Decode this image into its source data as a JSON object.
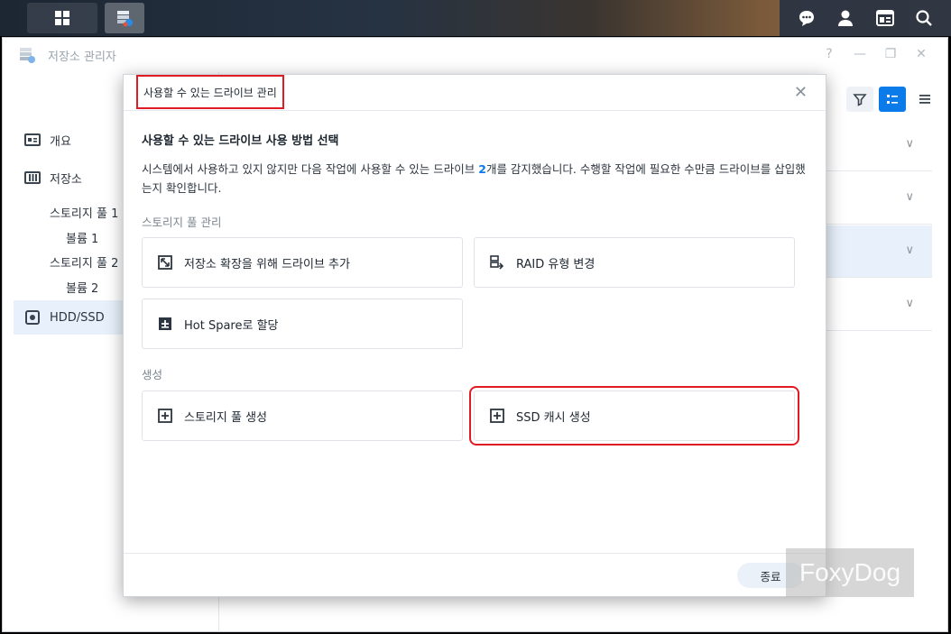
{
  "window": {
    "title": "저장소 관리자",
    "controls": [
      "?",
      "—",
      "❐",
      "✕"
    ]
  },
  "sidebar": {
    "items": [
      {
        "label": "개요",
        "icon": "overview-icon"
      },
      {
        "label": "저장소",
        "icon": "storage-icon"
      },
      {
        "label": "HDD/SSD",
        "icon": "hdd-icon"
      }
    ],
    "sub_items": [
      "스토리지 풀 1",
      "볼륨 1",
      "스토리지 풀 2",
      "볼륨 2"
    ]
  },
  "dialog": {
    "title": "사용할 수 있는 드라이브 관리",
    "heading": "사용할 수 있는 드라이브 사용 방법 선택",
    "desc_before": "시스템에서 사용하고 있지 않지만 다음 작업에 사용할 수 있는 드라이브 ",
    "desc_count": "2",
    "desc_after": "개를 감지했습니다. 수행할 작업에 필요한 수만큼 드라이브를 삽입했는지 확인합니다.",
    "section_pool": "스토리지 풀 관리",
    "section_create": "생성",
    "cards": {
      "add_drive": "저장소 확장을 위해 드라이브 추가",
      "raid_change": "RAID 유형 변경",
      "hot_spare": "Hot Spare로 할당",
      "create_pool": "스토리지 풀 생성",
      "create_ssd_cache": "SSD 캐시 생성"
    },
    "close_label": "종료"
  },
  "watermark": "FoxyDog",
  "colors": {
    "accent": "#0b7bea",
    "highlight": "#e01b24"
  }
}
